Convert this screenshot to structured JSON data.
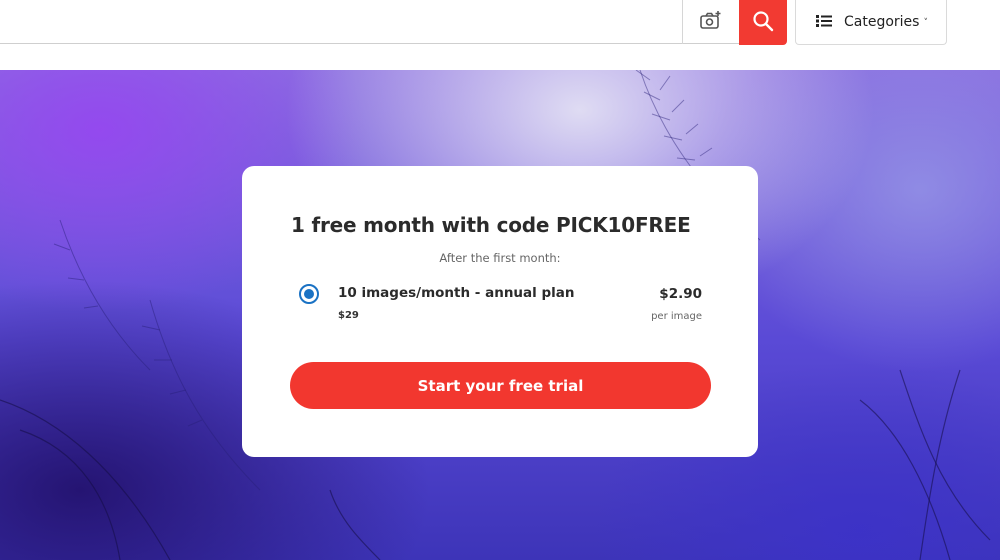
{
  "header": {
    "search": {
      "placeholder": "",
      "value": ""
    },
    "camera_icon": "camera-plus-icon",
    "search_icon": "search-icon",
    "search_button_color": "#f23a32",
    "categories_icon": "list-icon",
    "categories_label": "Categories",
    "categories_chevron": "˅"
  },
  "offer": {
    "title": "1 free month with code PICK10FREE",
    "subtitle": "After the first month:",
    "plan": {
      "selected": true,
      "name": "10 images/month - annual plan",
      "total": "$29",
      "price": "$2.90",
      "unit": "per image",
      "radio_color": "#1a72c4"
    },
    "cta_label": "Start your free trial",
    "cta_color": "#f2372f"
  },
  "hero": {
    "accent": "#5a4ad6"
  }
}
